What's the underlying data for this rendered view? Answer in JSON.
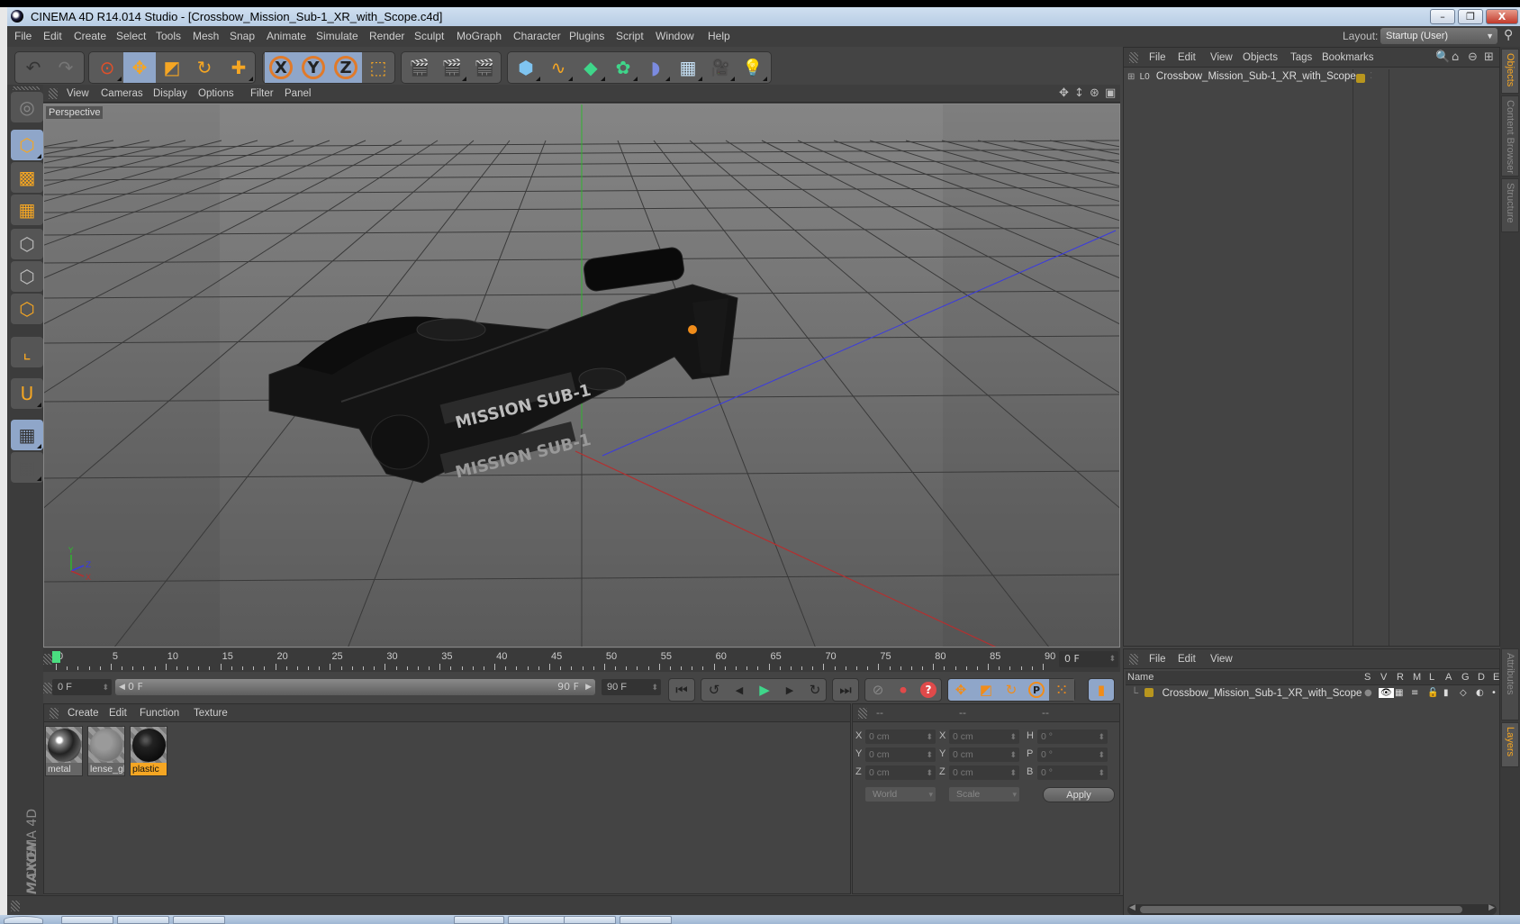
{
  "window": {
    "title": "CINEMA 4D R14.014 Studio - [Crossbow_Mission_Sub-1_XR_with_Scope.c4d]",
    "minimize": "–",
    "restore": "❐",
    "close": "X"
  },
  "menu": [
    "File",
    "Edit",
    "Create",
    "Select",
    "Tools",
    "Mesh",
    "Snap",
    "Animate",
    "Simulate",
    "Render",
    "Sculpt",
    "MoGraph",
    "Character",
    "Plugins",
    "Script",
    "Window",
    "Help"
  ],
  "layout": {
    "label": "Layout:",
    "value": "Startup (User)"
  },
  "toolbar": {
    "groups": [
      {
        "name": "history",
        "buttons": [
          {
            "icon": "undo-icon",
            "glyph": "↶"
          },
          {
            "icon": "redo-icon",
            "glyph": "↷"
          }
        ]
      },
      {
        "name": "tools",
        "buttons": [
          {
            "icon": "live-selection-icon",
            "glyph": "⊙"
          },
          {
            "icon": "move-icon",
            "glyph": "✥",
            "active": true
          },
          {
            "icon": "scale-icon",
            "glyph": "◩"
          },
          {
            "icon": "rotate-icon",
            "glyph": "↻"
          },
          {
            "icon": "last-tool-icon",
            "glyph": "✚"
          }
        ]
      },
      {
        "name": "axis",
        "buttons": [
          {
            "icon": "x-axis-lock-icon",
            "glyph": "X",
            "active": true
          },
          {
            "icon": "y-axis-lock-icon",
            "glyph": "Y",
            "active": true
          },
          {
            "icon": "z-axis-lock-icon",
            "glyph": "Z",
            "active": true
          },
          {
            "icon": "coordinate-system-icon",
            "glyph": "⬚"
          }
        ]
      },
      {
        "name": "render",
        "buttons": [
          {
            "icon": "render-view-icon",
            "glyph": "🎬"
          },
          {
            "icon": "render-picture-viewer-icon",
            "glyph": "🎬"
          },
          {
            "icon": "render-settings-icon",
            "glyph": "🎬"
          }
        ]
      },
      {
        "name": "objects",
        "buttons": [
          {
            "icon": "cube-primitive-icon",
            "glyph": "⬢"
          },
          {
            "icon": "spline-pen-icon",
            "glyph": "∿"
          },
          {
            "icon": "subdivision-surface-icon",
            "glyph": "◆"
          },
          {
            "icon": "cloner-icon",
            "glyph": "✿"
          },
          {
            "icon": "deformer-bend-icon",
            "glyph": "◗"
          },
          {
            "icon": "floor-scene-icon",
            "glyph": "▦"
          },
          {
            "icon": "camera-icon",
            "glyph": "🎥"
          },
          {
            "icon": "light-icon",
            "glyph": "💡"
          }
        ]
      }
    ]
  },
  "left_toolbar": [
    {
      "icon": "make-editable-icon",
      "glyph": "◎"
    },
    {
      "icon": "model-mode-icon",
      "glyph": "⬡",
      "active": true
    },
    {
      "icon": "texture-mode-icon",
      "glyph": "▩"
    },
    {
      "icon": "workplane-mode-icon",
      "glyph": "▦"
    },
    {
      "icon": "points-mode-icon",
      "glyph": "⬡"
    },
    {
      "icon": "edges-mode-icon",
      "glyph": "⬡"
    },
    {
      "icon": "polygons-mode-icon",
      "glyph": "⬡"
    },
    {
      "icon": "enable-axis-icon",
      "glyph": "⌞"
    },
    {
      "icon": "snapping-magnet-icon",
      "glyph": "U"
    },
    {
      "icon": "locked-workplane-icon",
      "glyph": "▦",
      "active": true
    },
    {
      "icon": "workplane-align-icon",
      "glyph": "▦"
    }
  ],
  "logo": {
    "brand": "MAXON",
    "product": "CINEMA 4D"
  },
  "viewport": {
    "menu": [
      "View",
      "Cameras",
      "Display",
      "Options",
      "Filter",
      "Panel"
    ],
    "label": "Perspective",
    "nav_icons": [
      {
        "icon": "pan-view-icon",
        "glyph": "✥"
      },
      {
        "icon": "zoom-view-icon",
        "glyph": "↕"
      },
      {
        "icon": "orbit-view-icon",
        "glyph": "⊛"
      },
      {
        "icon": "toggle-layout-icon",
        "glyph": "▣"
      }
    ],
    "axis": {
      "x": "X",
      "y": "Y",
      "z": "Z"
    },
    "colors": {
      "x_axis": "#b33030",
      "y_axis": "#2fb52f",
      "z_axis": "#3a3ae0"
    }
  },
  "timeline": {
    "start": 0,
    "end": 90,
    "current_frame": 0,
    "ticks": [
      0,
      5,
      10,
      15,
      20,
      25,
      30,
      35,
      40,
      45,
      50,
      55,
      60,
      65,
      70,
      75,
      80,
      85,
      90
    ],
    "current_field": "0 F",
    "range_start_field": "0 F",
    "range_slider_start": "0 F",
    "range_slider_end": "90 F",
    "range_end_field": "90 F"
  },
  "transport": {
    "nav": [
      {
        "icon": "go-to-start-icon",
        "glyph": "⏮"
      }
    ],
    "play": [
      {
        "icon": "previous-key-icon",
        "glyph": "↺"
      },
      {
        "icon": "previous-frame-icon",
        "glyph": "◀"
      },
      {
        "icon": "play-forward-icon",
        "glyph": "▶"
      },
      {
        "icon": "next-frame-icon",
        "glyph": "▶"
      },
      {
        "icon": "next-key-icon",
        "glyph": "↻"
      }
    ],
    "end": [
      {
        "icon": "go-to-end-icon",
        "glyph": "⏭"
      }
    ],
    "record": [
      {
        "icon": "record-active-objects-icon",
        "glyph": "⊘"
      },
      {
        "icon": "autokeying-icon",
        "glyph": "⏺"
      },
      {
        "icon": "keyframe-selection-icon",
        "glyph": "?"
      }
    ],
    "keys": [
      {
        "icon": "record-position-icon",
        "glyph": "✥"
      },
      {
        "icon": "record-scale-icon",
        "glyph": "◩"
      },
      {
        "icon": "record-rotation-icon",
        "glyph": "↻"
      },
      {
        "icon": "record-parameter-icon",
        "glyph": "P"
      },
      {
        "icon": "record-point-level-icon",
        "glyph": "⁙"
      }
    ],
    "timeline_btn": {
      "icon": "timeline-window-icon",
      "glyph": "▮"
    }
  },
  "materials": {
    "menu": [
      "Create",
      "Edit",
      "Function",
      "Texture"
    ],
    "items": [
      {
        "name": "metal",
        "selected": false
      },
      {
        "name": "lense_gl",
        "selected": false
      },
      {
        "name": "plastic",
        "selected": true
      }
    ]
  },
  "coordinates": {
    "headers": [
      "--",
      "--",
      "--"
    ],
    "position": [
      {
        "axis": "X",
        "value": "0 cm"
      },
      {
        "axis": "Y",
        "value": "0 cm"
      },
      {
        "axis": "Z",
        "value": "0 cm"
      }
    ],
    "size": [
      {
        "axis": "X",
        "value": "0 cm"
      },
      {
        "axis": "Y",
        "value": "0 cm"
      },
      {
        "axis": "Z",
        "value": "0 cm"
      }
    ],
    "rotation": [
      {
        "axis": "H",
        "value": "0 °"
      },
      {
        "axis": "P",
        "value": "0 °"
      },
      {
        "axis": "B",
        "value": "0 °"
      }
    ],
    "space_select": "World",
    "mode_select": "Scale",
    "apply": "Apply"
  },
  "objects_panel": {
    "menu": [
      "File",
      "Edit",
      "View",
      "Objects",
      "Tags",
      "Bookmarks"
    ],
    "tools": [
      {
        "icon": "search-icon",
        "glyph": "🔍"
      },
      {
        "icon": "home-icon",
        "glyph": "⌂"
      },
      {
        "icon": "link-icon",
        "glyph": "⊖"
      },
      {
        "icon": "new-panel-icon",
        "glyph": "⊞"
      }
    ],
    "objects": [
      {
        "name": "Crossbow_Mission_Sub-1_XR_with_Scope",
        "type_glyph": "L0",
        "expand": "⊞"
      }
    ]
  },
  "layers_panel": {
    "menu": [
      "File",
      "Edit",
      "View"
    ],
    "columns": [
      "Name",
      "S",
      "V",
      "R",
      "M",
      "L",
      "A",
      "G",
      "D",
      "E"
    ],
    "rows": [
      {
        "name": "Crossbow_Mission_Sub-1_XR_with_Scope"
      }
    ]
  },
  "right_tabs": [
    {
      "label": "Objects",
      "active": true
    },
    {
      "label": "Content Browser",
      "active": false
    },
    {
      "label": "Structure",
      "active": false
    },
    {
      "label": "Attributes",
      "active": false
    },
    {
      "label": "Layers",
      "active": true
    }
  ]
}
